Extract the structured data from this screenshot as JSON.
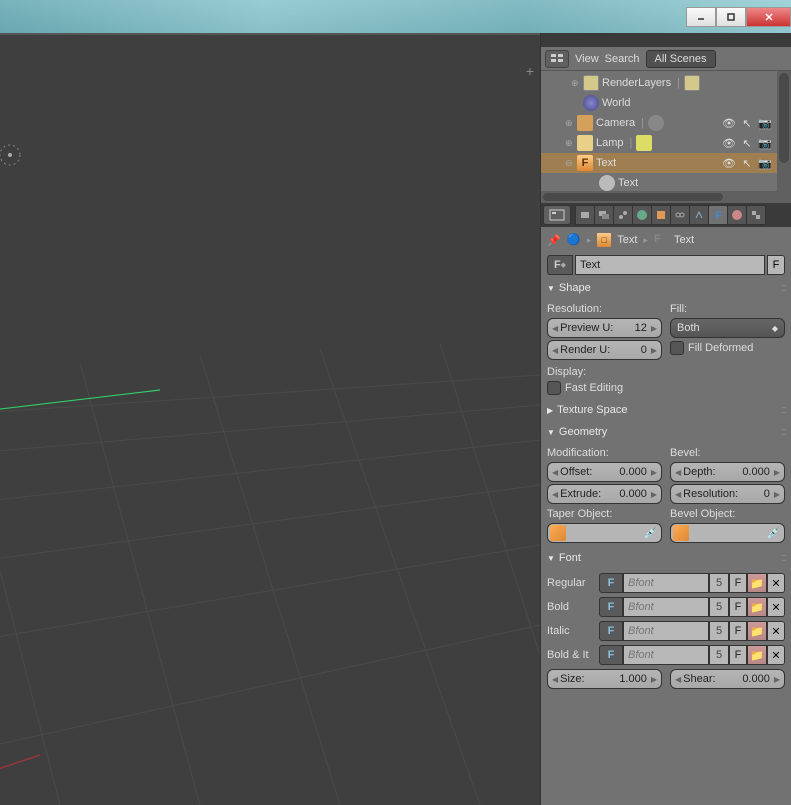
{
  "titlebar": {
    "minimize": "_",
    "maximize": "□",
    "close": "×"
  },
  "outliner_header": {
    "view": "View",
    "search": "Search",
    "scene_selector": "All Scenes"
  },
  "outliner": {
    "items": [
      {
        "label": "RenderLayers",
        "icon": "render-layers"
      },
      {
        "label": "World",
        "icon": "world"
      },
      {
        "label": "Camera",
        "icon": "camera"
      },
      {
        "label": "Lamp",
        "icon": "lamp"
      },
      {
        "label": "Text",
        "icon": "text",
        "selected": true
      },
      {
        "label": "Text",
        "icon": "text-data"
      }
    ]
  },
  "breadcrumb": {
    "obj": "Text",
    "data": "Text"
  },
  "name_field": "Text",
  "name_field_f": "F",
  "panels": {
    "shape": {
      "title": "Shape",
      "resolution_label": "Resolution:",
      "preview_u_label": "Preview U:",
      "preview_u_val": "12",
      "render_u_label": "Render U:",
      "render_u_val": "0",
      "fill_label": "Fill:",
      "fill_mode": "Both",
      "fill_deformed": "Fill Deformed",
      "display_label": "Display:",
      "fast_editing": "Fast Editing"
    },
    "texture_space": {
      "title": "Texture Space"
    },
    "geometry": {
      "title": "Geometry",
      "modification_label": "Modification:",
      "offset_label": "Offset:",
      "offset_val": "0.000",
      "extrude_label": "Extrude:",
      "extrude_val": "0.000",
      "bevel_label": "Bevel:",
      "depth_label": "Depth:",
      "depth_val": "0.000",
      "bresolution_label": "Resolution:",
      "bresolution_val": "0",
      "taper_label": "Taper Object:",
      "bevel_obj_label": "Bevel Object:"
    },
    "font": {
      "title": "Font",
      "regular": "Regular",
      "bold": "Bold",
      "italic": "Italic",
      "bold_italic": "Bold & It",
      "bfont": "Bfont",
      "fnum": "5",
      "ff": "F",
      "size_label": "Size:",
      "size_val": "1.000",
      "shear_label": "Shear:",
      "shear_val": "0.000"
    }
  }
}
